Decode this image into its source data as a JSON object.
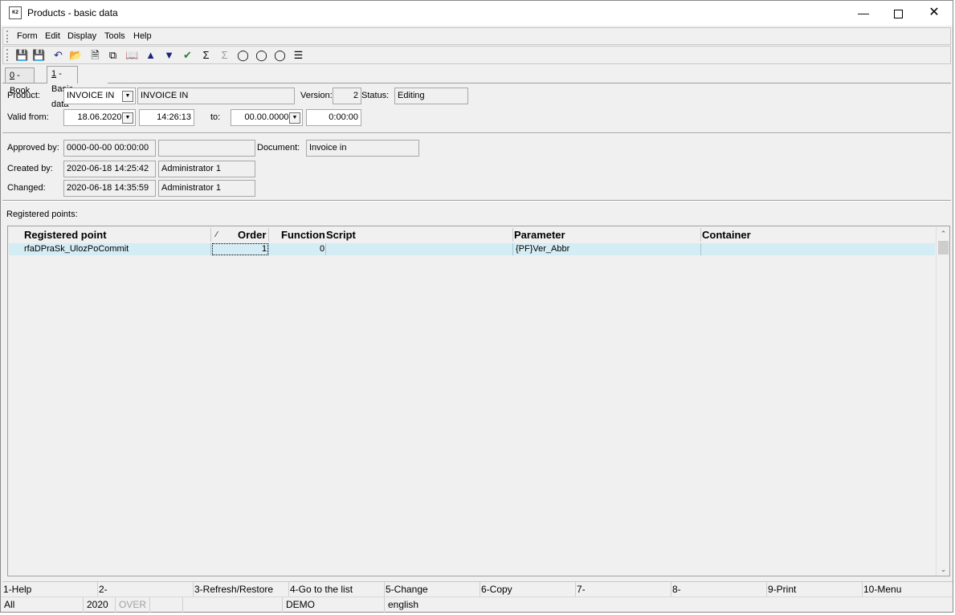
{
  "window": {
    "title": "Products - basic data",
    "icon_text": "K2",
    "icons": {
      "minimize": "minimize-icon",
      "maximize": "maximize-icon",
      "close": "close-icon"
    }
  },
  "menu": [
    "Form",
    "Edit",
    "Display",
    "Tools",
    "Help"
  ],
  "toolbar_icons": [
    "save-icon",
    "save-as-icon",
    "undo-icon",
    "open-folder-icon",
    "new-document-icon",
    "copy-icon",
    "book-icon",
    "arrow-up-icon",
    "arrow-down-icon",
    "checkmark-icon",
    "sum-icon",
    "sum-disabled-icon",
    "binoculars-icon",
    "binoculars-filter-icon",
    "binoculars-next-icon",
    "menu-lines-icon"
  ],
  "tabs": [
    {
      "key": "0",
      "label": " - Book"
    },
    {
      "key": "1",
      "label": " - Basic data"
    }
  ],
  "form": {
    "product_label": "Product:",
    "product_code": "INVOICE IN",
    "product_name": "INVOICE IN",
    "version_label": "Version:",
    "version_value": "2",
    "status_label": "Status:",
    "status_value": "Editing",
    "valid_from_label": "Valid from:",
    "valid_from_date": "18.06.2020",
    "valid_from_time": "14:26:13",
    "to_label": "to:",
    "to_date": "00.00.0000",
    "to_time": "0:00:00",
    "approved_label": "Approved by:",
    "approved_date": "0000-00-00 00:00:00",
    "approved_user": "",
    "document_label": "Document:",
    "document_value": "Invoice in",
    "created_label": "Created by:",
    "created_date": "2020-06-18 14:25:42",
    "created_user": "Administrator 1",
    "changed_label": "Changed:",
    "changed_date": "2020-06-18 14:35:59",
    "changed_user": "Administrator 1"
  },
  "grid": {
    "title": "Registered points:",
    "sort_mark": "⁄",
    "columns": [
      "Registered point",
      "Order",
      "Function",
      "Script",
      "Parameter",
      "Container"
    ],
    "rows": [
      {
        "registered_point": "rfaDPraSk_UlozPoCommit",
        "order": "1",
        "function": "0",
        "script": "",
        "parameter": "{PF}Ver_Abbr",
        "container": ""
      }
    ]
  },
  "fkeys": [
    "1-Help",
    "2-",
    "3-Refresh/Restore",
    "4-Go to the list",
    "5-Change",
    "6-Copy",
    "7-",
    "8-",
    "9-Print",
    "10-Menu"
  ],
  "status": {
    "scope": "All",
    "year": "2020",
    "mode": "OVER",
    "blank1": "",
    "blank2": "",
    "database": "DEMO",
    "language": "english"
  }
}
